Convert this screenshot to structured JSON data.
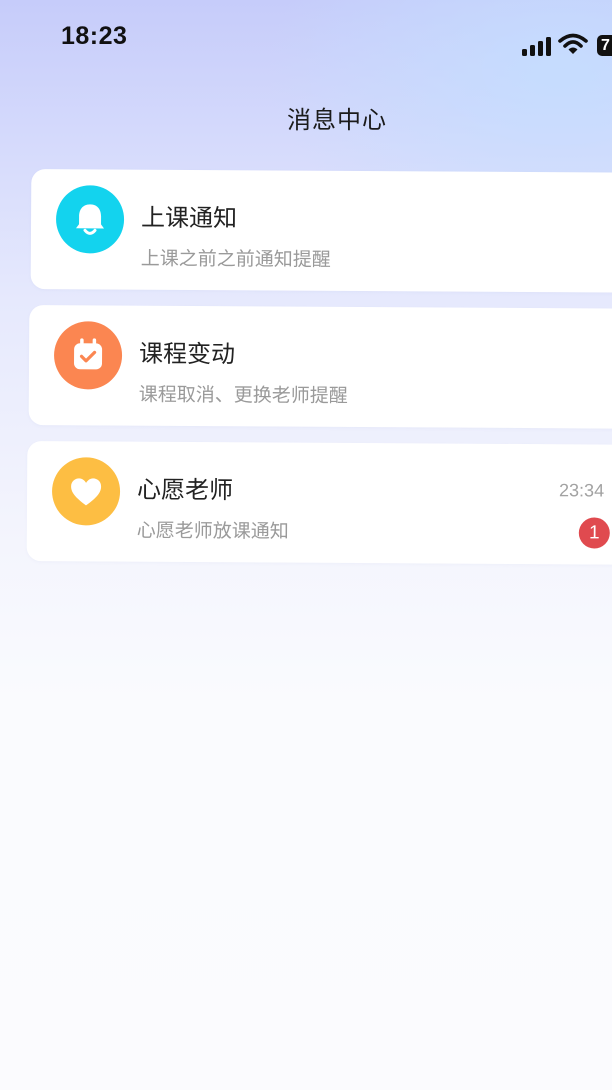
{
  "status_bar": {
    "time": "18:23",
    "signal_icon": "cellular-signal-icon",
    "wifi_icon": "wifi-icon",
    "battery_level": "7"
  },
  "header": {
    "title": "消息中心"
  },
  "messages": [
    {
      "title": "上课通知",
      "subtitle": "上课之前之前通知提醒",
      "icon": "bell-icon",
      "icon_bg": "#13d3ee"
    },
    {
      "title": "课程变动",
      "subtitle": "课程取消、更换老师提醒",
      "icon": "calendar-check-icon",
      "icon_bg": "#fb8651"
    },
    {
      "title": "心愿老师",
      "subtitle": "心愿老师放课通知",
      "icon": "heart-icon",
      "icon_bg": "#fdbe43",
      "time": "23:34",
      "unread_count": "1",
      "badge_color": "#e04a4f"
    }
  ]
}
